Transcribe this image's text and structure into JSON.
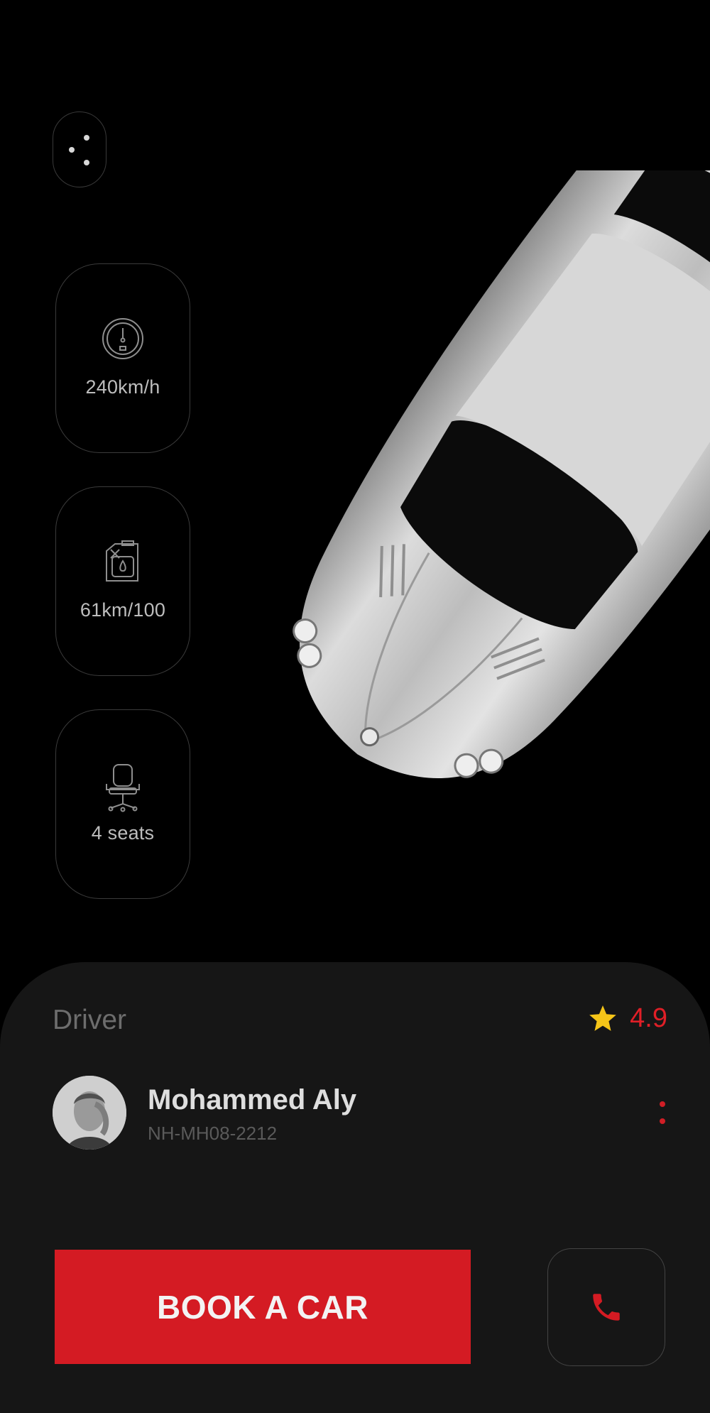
{
  "header": {
    "menu_icon": "dots-menu-icon"
  },
  "specs": [
    {
      "icon": "speedometer-icon",
      "label": "240km/h"
    },
    {
      "icon": "fuel-can-icon",
      "label": "61km/100"
    },
    {
      "icon": "seat-icon",
      "label": "4 seats"
    }
  ],
  "car": {
    "icon": "sports-car-image",
    "color": "#c9c9c9"
  },
  "driver": {
    "section_label": "Driver",
    "rating": "4.9",
    "rating_icon": "star-icon",
    "name": "Mohammed Aly",
    "plate": "NH-MH08-2212",
    "more_icon": "more-vertical-icon"
  },
  "actions": {
    "book_label": "BOOK A CAR",
    "call_icon": "phone-icon"
  },
  "colors": {
    "accent": "#d41b23",
    "star": "#f5c518",
    "background": "#000000",
    "panel": "#161616"
  }
}
